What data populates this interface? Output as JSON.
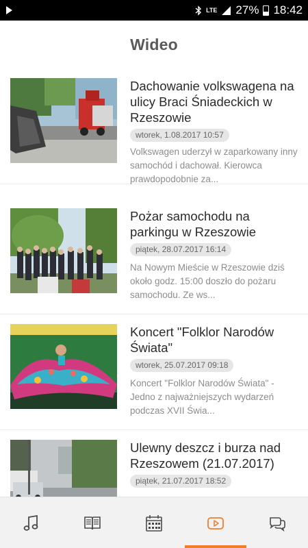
{
  "status_bar": {
    "network": "LTE",
    "battery": "27%",
    "time": "18:42",
    "icons": [
      "play-icon",
      "bluetooth-icon",
      "signal-icon",
      "battery-icon"
    ]
  },
  "header": {
    "title": "Wideo"
  },
  "videos": [
    {
      "title": "Dachowanie volkswagena na ulicy Braci Śniadeckich w Rzeszowie",
      "date": "wtorek, 1.08.2017 10:57",
      "excerpt": "Volkswagen uderzył w zaparkowany inny samochód i dachował. Kierowca prawdopodobnie za..."
    },
    {
      "title": "Pożar samochodu na parkingu w Rzeszowie",
      "date": "piątek, 28.07.2017 16:14",
      "excerpt": "Na Nowym Mieście w Rzeszowie dziś około godz. 15:00 doszło do pożaru samochodu. Ze ws..."
    },
    {
      "title": "Koncert \"Folklor Narodów Świata\"",
      "date": "wtorek, 25.07.2017 09:18",
      "excerpt": "Koncert \"Folklor Narodów Świata\" - Jedno z najważniejszych wydarzeń podczas XVII Świa..."
    },
    {
      "title": "Ulewny deszcz i burza nad Rzeszowem (21.07.2017)",
      "date": "piątek, 21.07.2017 18:52",
      "excerpt": ""
    }
  ],
  "tabs": [
    {
      "icon": "music-note-icon",
      "active": false
    },
    {
      "icon": "book-icon",
      "active": false
    },
    {
      "icon": "calendar-icon",
      "active": false
    },
    {
      "icon": "video-play-icon",
      "active": true
    },
    {
      "icon": "chat-bubbles-icon",
      "active": false
    }
  ],
  "colors": {
    "accent": "#f07f2a",
    "icon_inactive": "#4a4a4a",
    "title_text": "#595959"
  }
}
